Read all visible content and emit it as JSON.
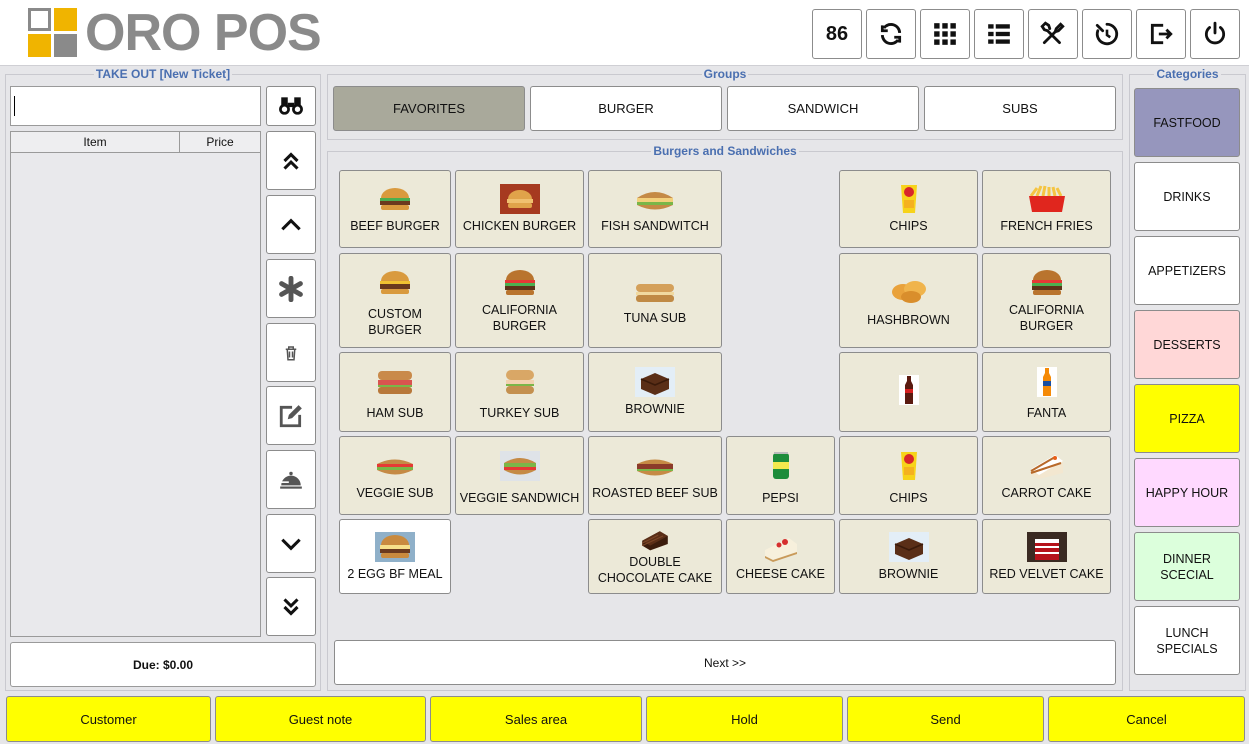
{
  "header": {
    "logo_text": "ORO POS",
    "logo_colors": [
      "#f0b400",
      "#8a8a8a",
      "#8a8a8a",
      "#f0b400"
    ],
    "buttons": [
      {
        "name": "table-count-button",
        "label": "86",
        "icon": ""
      },
      {
        "name": "refresh-button",
        "label": "",
        "icon": "refresh-icon"
      },
      {
        "name": "apps-button",
        "label": "",
        "icon": "grid-icon"
      },
      {
        "name": "orders-list-button",
        "label": "",
        "icon": "list-icon"
      },
      {
        "name": "tools-button",
        "label": "",
        "icon": "tools-icon"
      },
      {
        "name": "clock-out-button",
        "label": "",
        "icon": "timer-icon"
      },
      {
        "name": "logout-button",
        "label": "",
        "icon": "logout-icon"
      },
      {
        "name": "power-button",
        "label": "",
        "icon": "power-icon"
      }
    ]
  },
  "ticket": {
    "title": "TAKE OUT [New Ticket]",
    "search_value": "",
    "columns": [
      "Item",
      "Price"
    ],
    "rows": [],
    "due": "Due: $0.00",
    "side_buttons": [
      "binoculars-icon",
      "double-chevron-up-icon",
      "chevron-up-icon",
      "asterisk-icon",
      "trash-icon",
      "edit-icon",
      "cloche-icon",
      "chevron-down-icon",
      "double-chevron-down-icon"
    ]
  },
  "groups": {
    "title": "Groups",
    "items": [
      {
        "label": "FAVORITES",
        "selected": true
      },
      {
        "label": "BURGER",
        "selected": false
      },
      {
        "label": "SANDWICH",
        "selected": false
      },
      {
        "label": "SUBS",
        "selected": false
      }
    ]
  },
  "menu": {
    "title": "Burgers and Sandwiches",
    "items": [
      {
        "label": "BEEF BURGER",
        "icon": "burger-icon"
      },
      {
        "label": "CHICKEN BURGER",
        "icon": "chicken-burger-icon"
      },
      {
        "label": "FISH SANDWITCH",
        "icon": "sandwich-icon"
      },
      {
        "label": "CHIPS",
        "icon": "chips-icon"
      },
      {
        "label": "FRENCH FRIES",
        "icon": "fries-icon"
      },
      {
        "label": "CUSTOM BURGER",
        "icon": "burger-icon"
      },
      {
        "label": "CALIFORNIA BURGER",
        "icon": "burger-icon"
      },
      {
        "label": "TUNA SUB",
        "icon": "sub-icon"
      },
      {
        "label": "HASHBROWN",
        "icon": "hashbrown-icon"
      },
      {
        "label": "CALIFORNIA BURGER",
        "icon": "burger-icon"
      },
      {
        "label": "HAM SUB",
        "icon": "sub-icon"
      },
      {
        "label": "TURKEY SUB",
        "icon": "sub-icon"
      },
      {
        "label": "BROWNIE",
        "icon": "brownie-icon"
      },
      {
        "label": "",
        "icon": "cola-bottle-icon"
      },
      {
        "label": "FANTA",
        "icon": "fanta-bottle-icon"
      },
      {
        "label": "VEGGIE SUB",
        "icon": "sub-icon"
      },
      {
        "label": "VEGGIE SANDWICH",
        "icon": "sandwich-icon"
      },
      {
        "label": "ROASTED BEEF SUB",
        "icon": "sub-icon"
      },
      {
        "label": "PEPSI",
        "icon": "soda-can-icon"
      },
      {
        "label": "CHIPS",
        "icon": "chips-icon"
      },
      {
        "label": "CARROT CAKE",
        "icon": "cake-icon"
      },
      {
        "label": "2 EGG BF MEAL",
        "icon": "burger-icon"
      },
      {
        "label": "DOUBLE CHOCOLATE CAKE",
        "icon": "chocolate-cake-icon"
      },
      {
        "label": "CHEESE CAKE",
        "icon": "cheesecake-icon"
      },
      {
        "label": "BROWNIE",
        "icon": "brownie-icon"
      },
      {
        "label": "RED VELVET CAKE",
        "icon": "red-velvet-icon"
      }
    ],
    "next_label": "Next >>"
  },
  "categories": {
    "title": "Categories",
    "items": [
      {
        "label": "FASTFOOD",
        "color": "#9696bd"
      },
      {
        "label": "DRINKS",
        "color": "#ffffff"
      },
      {
        "label": "APPETIZERS",
        "color": "#ffffff"
      },
      {
        "label": "DESSERTS",
        "color": "#ffd7d7"
      },
      {
        "label": "PIZZA",
        "color": "#ffff00"
      },
      {
        "label": "HAPPY HOUR",
        "color": "#ffd9ff"
      },
      {
        "label": "DINNER SCECIAL",
        "color": "#dcffdc"
      },
      {
        "label": "LUNCH SPECIALS",
        "color": "#ffffff"
      }
    ]
  },
  "footer": {
    "buttons": [
      "Customer",
      "Guest note",
      "Sales area",
      "Hold",
      "Send",
      "Cancel"
    ],
    "color": "#ffff00"
  }
}
